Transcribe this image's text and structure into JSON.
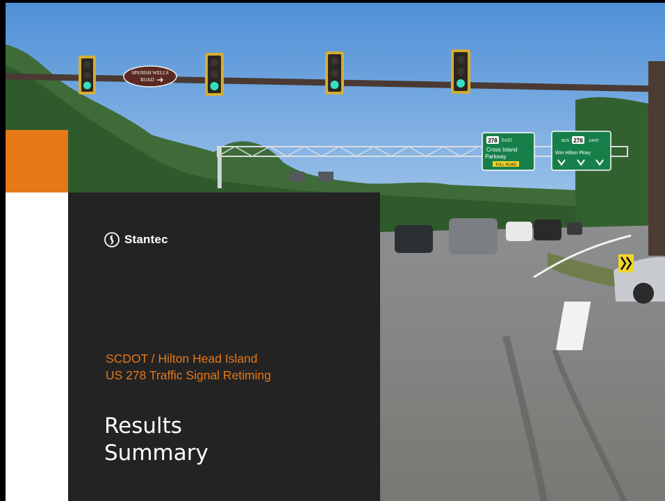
{
  "slide": {
    "logo_text": "Stantec",
    "subtitle_line1": "SCDOT / Hilton Head Island",
    "subtitle_line2": "US 278 Traffic Signal Retiming",
    "title_line1": "Results",
    "title_line2": "Summary",
    "accent_color": "#e77817",
    "panel_color": "#232323"
  },
  "photo_signs": {
    "street_sign_line1": "SPANISH WELLS",
    "street_sign_line2": "ROAD",
    "green_sign_1": {
      "route": "278",
      "direction": "EAST",
      "line1": "Cross Island",
      "line2": "Parkway",
      "toll": "TOLL ROAD"
    },
    "green_sign_2": {
      "prefix": "BUS",
      "route": "278",
      "direction": "EAST",
      "line1": "Wm Hilton Pkwy"
    }
  }
}
